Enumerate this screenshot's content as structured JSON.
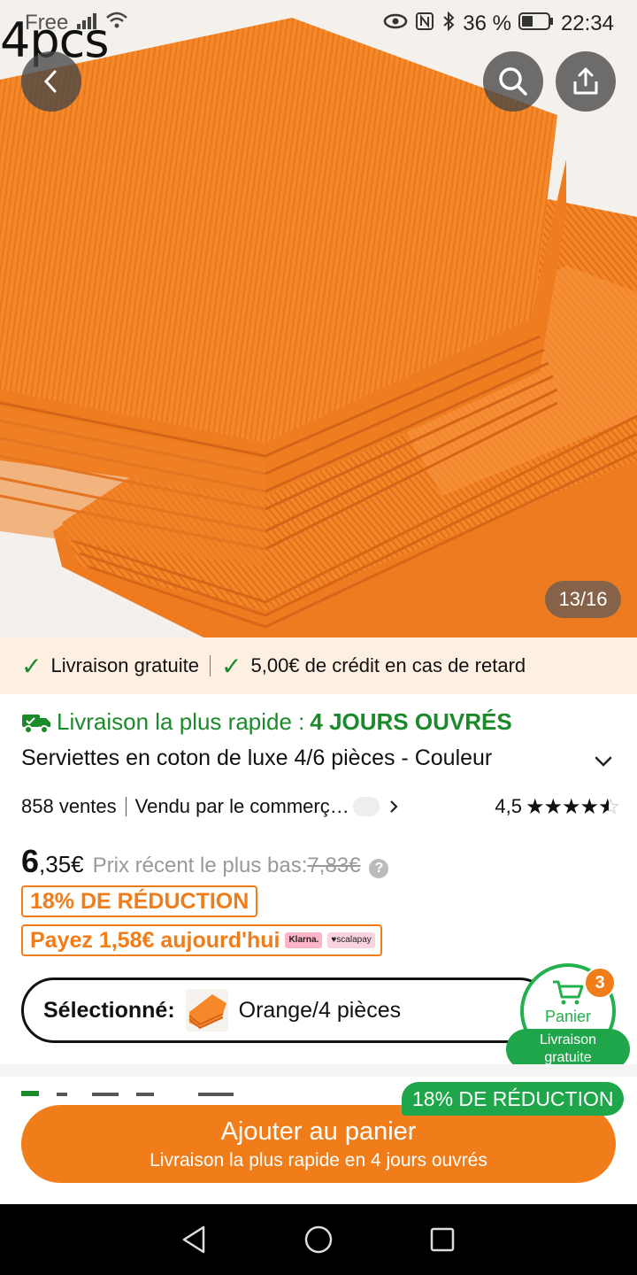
{
  "status_bar": {
    "carrier": "Free",
    "battery": "36 %",
    "time": "22:34"
  },
  "hero": {
    "overlay_text": "4pcs",
    "pager": "13/16"
  },
  "delivery_strip": {
    "item1": "Livraison gratuite",
    "item2": "5,00€ de crédit en cas de retard"
  },
  "product": {
    "fastest_label": "Livraison la plus rapide : ",
    "fastest_value": "4 JOURS OUVRÉS",
    "title": "Serviettes en coton de luxe 4/6 pièces - Couleur",
    "sales": "858 ventes",
    "seller": "Vendu par le commerç…",
    "rating": "4,5",
    "price_int": "6",
    "price_dec": ",35€",
    "recent_low_label": "Prix récent le plus bas:",
    "recent_low_value": "7,83€",
    "discount_badge": "18% DE RÉDUCTION",
    "pay_today": "Payez 1,58€ aujourd'hui",
    "klarna": "Klarna.",
    "scalapay": "♥scalapay"
  },
  "selection": {
    "label": "Sélectionné:",
    "value": "Orange/4 pièces"
  },
  "cart": {
    "label": "Panier",
    "count": "3",
    "shipping_line1": "Livraison",
    "shipping_line2": "gratuite"
  },
  "cta": {
    "discount_tag": "18% DE RÉDUCTION",
    "main": "Ajouter au panier",
    "sub": "Livraison la plus rapide en 4 jours ouvrés"
  },
  "colors": {
    "accent_orange": "#f07d1a",
    "green": "#1fa64a",
    "strip_bg": "#fdf0e2"
  }
}
